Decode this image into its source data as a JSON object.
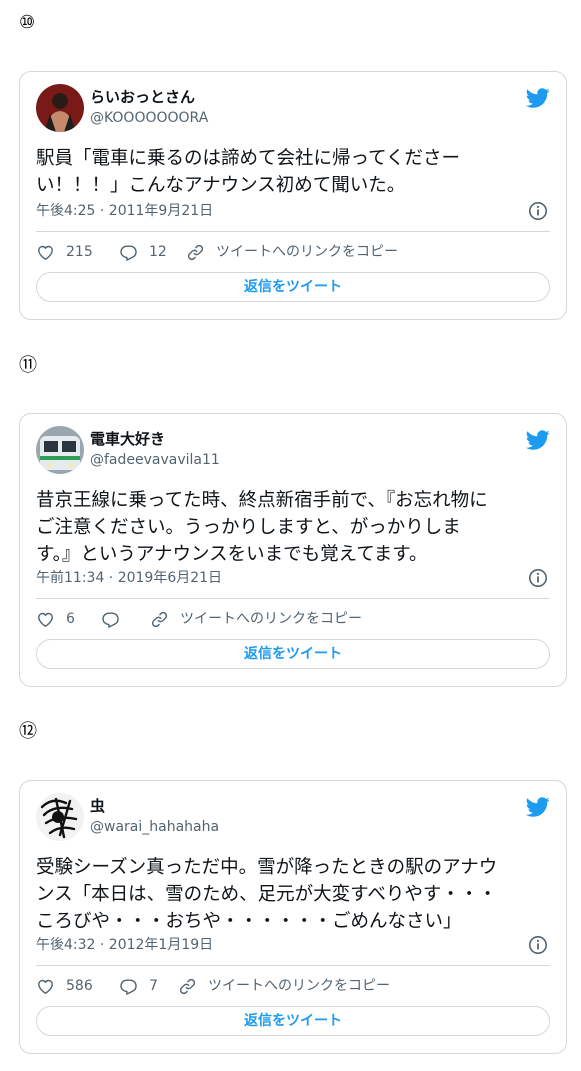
{
  "tweets": [
    {
      "number": "⑩",
      "name": "らいおっとさん",
      "handle": "@KOOOOOOORA",
      "text": "駅員「電車に乗るのは諦めて会社に帰ってくださー\nい！！！」こんなアナウンス初めて聞いた。",
      "timestamp": "午後4:25 · 2011年9月21日",
      "likes": "215",
      "replies": "12",
      "copy_link_label": "ツイートへのリンクをコピー",
      "reply_button_label": "返信をツイート"
    },
    {
      "number": "⑪",
      "name": "電車大好き",
      "handle": "@fadeevavavila11",
      "text": "昔京王線に乗ってた時、終点新宿手前で、『お忘れ物に\nご注意ください。うっかりしますと、がっかりしま\nす。』というアナウンスをいまでも覚えてます。",
      "timestamp": "午前11:34 · 2019年6月21日",
      "likes": "6",
      "replies": "",
      "copy_link_label": "ツイートへのリンクをコピー",
      "reply_button_label": "返信をツイート"
    },
    {
      "number": "⑫",
      "name": "虫",
      "handle": "@warai_hahahaha",
      "text": "受験シーズン真っただ中。雪が降ったときの駅のアナウ\nンス「本日は、雪のため、足元が大変すべりやす・・・\nころびや・・・おちや・・・・・・ごめんなさい」",
      "timestamp": "午後4:32 · 2012年1月19日",
      "likes": "586",
      "replies": "7",
      "copy_link_label": "ツイートへのリンクをコピー",
      "reply_button_label": "返信をツイート"
    }
  ],
  "icons": {
    "brand": "twitter-bird-icon",
    "like": "heart-icon",
    "reply": "speech-bubble-icon",
    "copy_link": "link-icon",
    "info": "info-icon"
  },
  "colors": {
    "twitter_blue": "#1d9bf0",
    "secondary_text": "#536471",
    "border": "#cfd9de"
  }
}
